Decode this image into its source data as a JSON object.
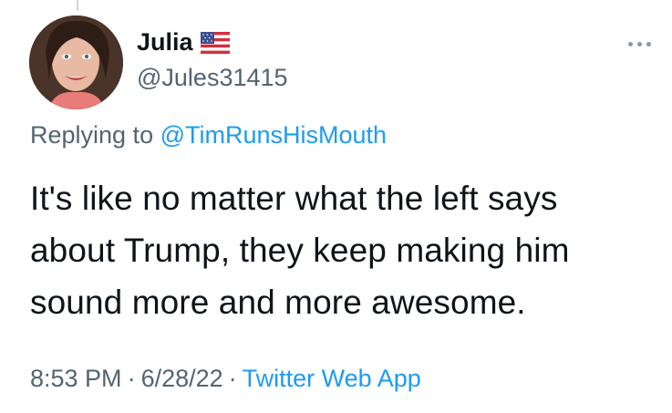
{
  "author": {
    "display_name": "Julia",
    "handle": "@Jules31415",
    "flag_icon": "us-flag-icon"
  },
  "reply": {
    "prefix": "Replying to ",
    "target": "@TimRunsHisMouth"
  },
  "tweet": {
    "text_lines": [
      "It's like no matter what the left says",
      "about Trump, they keep making him",
      "sound more and more awesome."
    ]
  },
  "meta": {
    "time": "8:53 PM",
    "separator": "·",
    "date": "6/28/22",
    "source": "Twitter Web App"
  },
  "colors": {
    "link": "#1d9bf0",
    "secondary": "#536471",
    "primary": "#0f1419"
  }
}
